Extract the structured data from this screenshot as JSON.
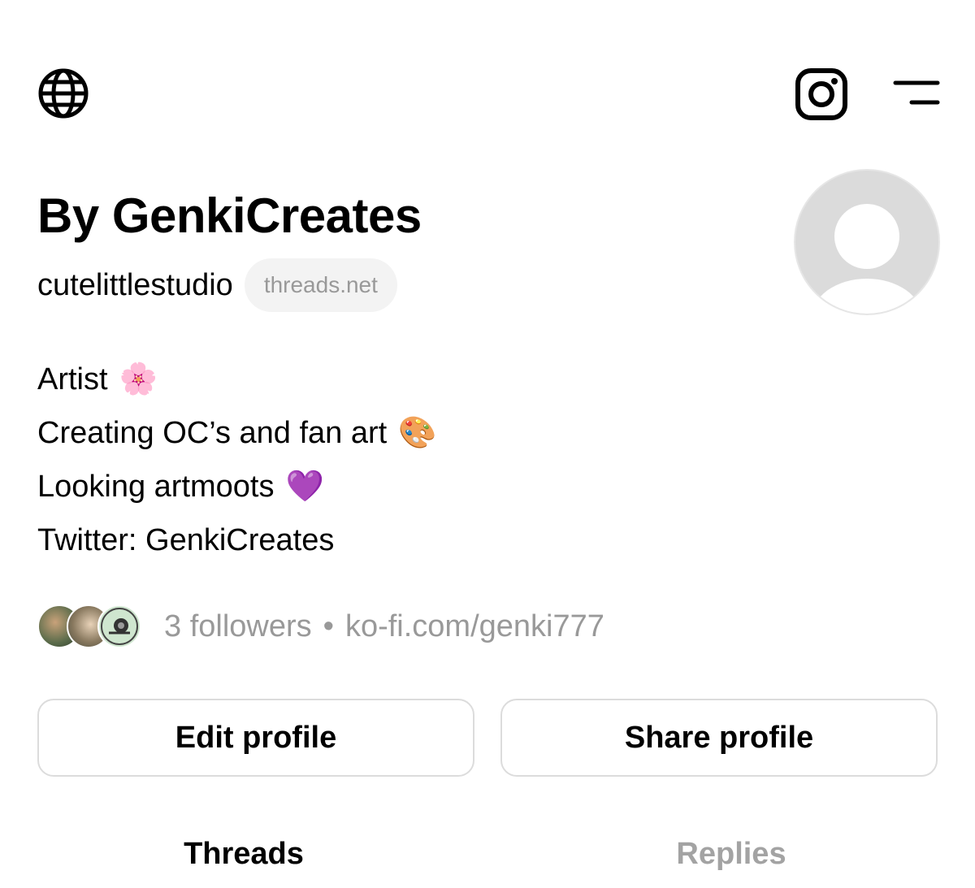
{
  "header": {
    "icons": [
      "globe-icon",
      "instagram-icon",
      "menu-icon"
    ]
  },
  "profile": {
    "display_name": "By GenkiCreates",
    "handle": "cutelittlestudio",
    "domain_badge": "threads.net",
    "avatar_icon": "default-avatar-icon"
  },
  "bio": {
    "lines": [
      {
        "text": "Artist",
        "emoji": "🌸"
      },
      {
        "text": "Creating OC’s and fan art",
        "emoji": "🎨"
      },
      {
        "text": "Looking artmoots",
        "emoji": "💜"
      },
      {
        "text": "Twitter: GenkiCreates",
        "emoji": ""
      }
    ]
  },
  "stats": {
    "followers": "3 followers",
    "separator": "•",
    "link": "ko-fi.com/genki777"
  },
  "actions": {
    "edit_label": "Edit profile",
    "share_label": "Share profile"
  },
  "tabs": [
    {
      "label": "Threads",
      "active": true
    },
    {
      "label": "Replies",
      "active": false
    }
  ],
  "colors": {
    "text": "#000000",
    "muted": "#999999",
    "inactive_tab": "#a3a3a3",
    "button_border": "#dcdcdc",
    "pill_bg": "#f3f3f3",
    "avatar_gray": "#dbdbdb"
  }
}
